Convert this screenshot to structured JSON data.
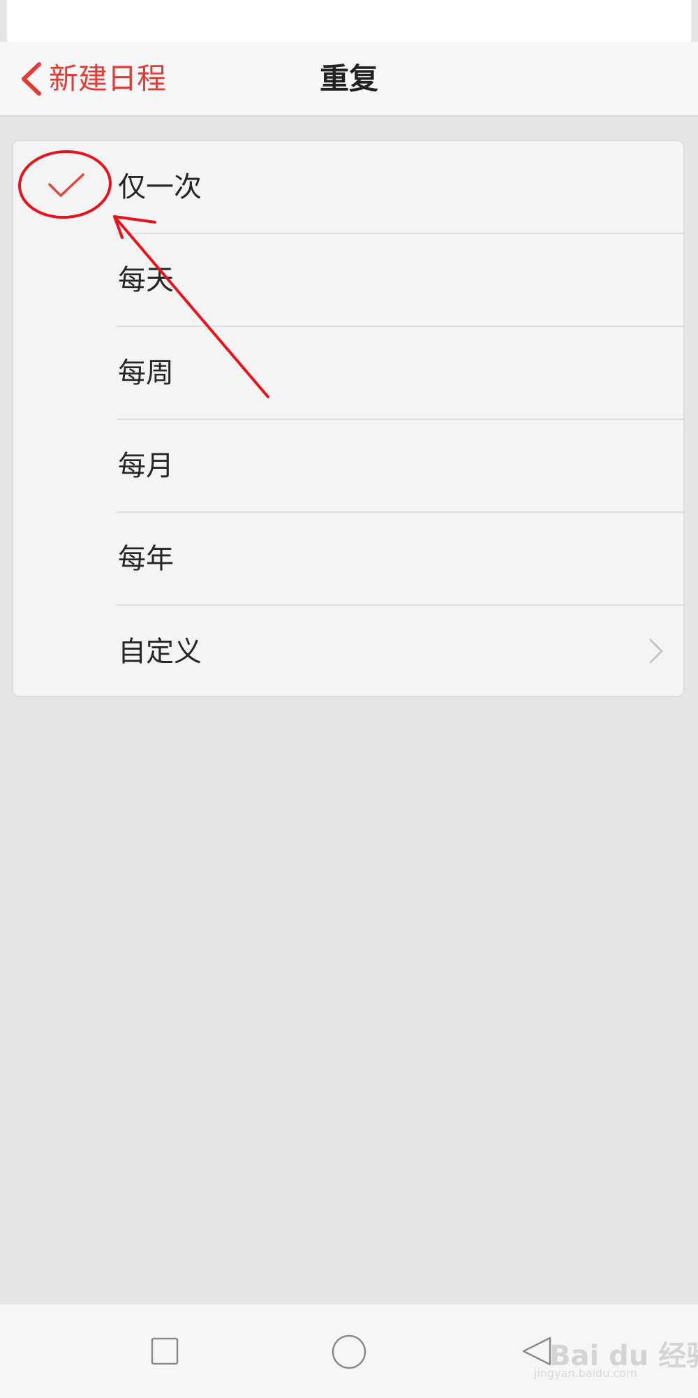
{
  "header": {
    "back_label": "新建日程",
    "title": "重复"
  },
  "options": [
    {
      "label": "仅一次",
      "selected": true,
      "has_chevron": false
    },
    {
      "label": "每天",
      "selected": false,
      "has_chevron": false
    },
    {
      "label": "每周",
      "selected": false,
      "has_chevron": false
    },
    {
      "label": "每月",
      "selected": false,
      "has_chevron": false
    },
    {
      "label": "每年",
      "selected": false,
      "has_chevron": false
    },
    {
      "label": "自定义",
      "selected": false,
      "has_chevron": true
    }
  ],
  "icons": {
    "back": "chevron-left-icon",
    "selected": "check-icon",
    "more": "chevron-right-icon",
    "recent_apps": "square-icon",
    "home": "circle-icon",
    "back_nav": "triangle-left-icon"
  },
  "colors": {
    "accent": "#e23b33",
    "annotation": "#e8121a",
    "background": "#e6e6e6",
    "card": "#f4f4f4"
  },
  "watermark": {
    "text": "Bai du 经验",
    "sub": "jingyan.baidu.com"
  }
}
